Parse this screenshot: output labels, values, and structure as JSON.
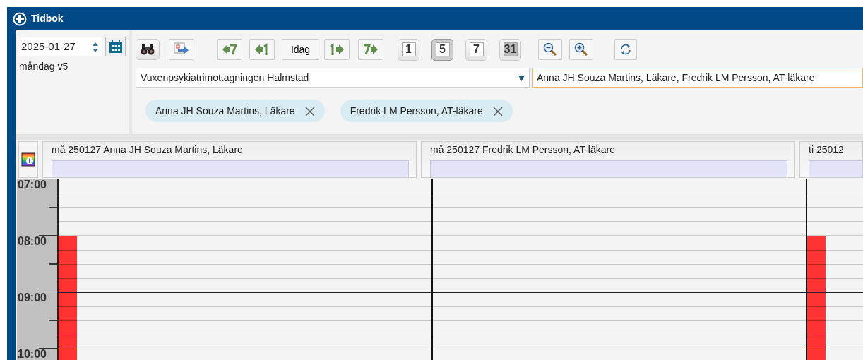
{
  "window": {
    "title": "Tidbok"
  },
  "date_field": {
    "value": "2025-01-27"
  },
  "weekday_label": "måndag v5",
  "toolbar": [
    {
      "kind": "search"
    },
    {
      "kind": "export"
    },
    {
      "kind": "back7"
    },
    {
      "kind": "back1"
    },
    {
      "kind": "today",
      "label": "Idag"
    },
    {
      "kind": "fwd1"
    },
    {
      "kind": "fwd7"
    },
    {
      "kind": "view",
      "label": "1",
      "selected": false,
      "disabled": false
    },
    {
      "kind": "view",
      "label": "5",
      "selected": true,
      "disabled": false
    },
    {
      "kind": "view",
      "label": "7",
      "selected": false,
      "disabled": false
    },
    {
      "kind": "view",
      "label": "31",
      "selected": false,
      "disabled": true
    },
    {
      "kind": "zoomout"
    },
    {
      "kind": "zoomin"
    },
    {
      "kind": "refresh"
    }
  ],
  "unit_dropdown": {
    "value": "Vuxenpsykiatrimottagningen Halmstad"
  },
  "staff_field": {
    "value": "Anna JH Souza Martins, Läkare, Fredrik LM Persson, AT-läkare"
  },
  "chips": [
    {
      "label": "Anna JH Souza Martins, Läkare"
    },
    {
      "label": "Fredrik LM Persson, AT-läkare"
    }
  ],
  "hours": [
    "07:00",
    "08:00",
    "09:00",
    "10:00"
  ],
  "columns": [
    {
      "header": "må 250127 Anna JH Souza Martins, Läkare",
      "blocked": [
        false,
        true,
        true,
        true
      ]
    },
    {
      "header": "må 250127 Fredrik LM Persson, AT-läkare",
      "blocked": [
        false,
        false,
        false,
        false
      ]
    },
    {
      "header": "ti 25012",
      "blocked": [
        false,
        true,
        true,
        true
      ]
    }
  ]
}
